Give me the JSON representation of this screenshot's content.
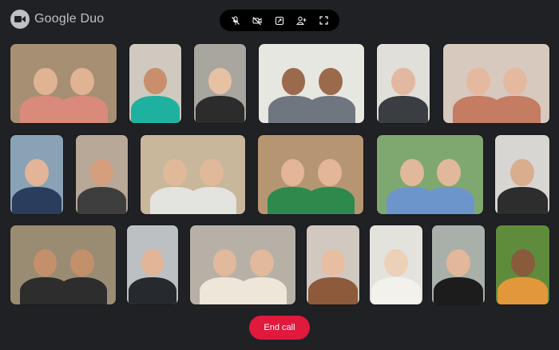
{
  "app": {
    "name": "Google Duo"
  },
  "toolbar": {
    "buttons": [
      {
        "name": "mute-mic-button",
        "icon": "mic-off-icon"
      },
      {
        "name": "camera-off-button",
        "icon": "video-off-icon"
      },
      {
        "name": "switch-view-button",
        "icon": "switch-view-icon"
      },
      {
        "name": "add-person-button",
        "icon": "person-add-icon"
      },
      {
        "name": "fullscreen-button",
        "icon": "fullscreen-icon"
      }
    ]
  },
  "participants": [
    {
      "bg": "#a68f73",
      "skin": "#e0b393",
      "shirt": "#d98a7a"
    },
    {
      "bg": "#cfc9bf",
      "skin": "#c98f6c",
      "shirt": "#1fb1a0"
    },
    {
      "bg": "#a9a59f",
      "skin": "#e6c2a3",
      "shirt": "#2c2c2c"
    },
    {
      "bg": "#e7e7e2",
      "skin": "#9b6a4c",
      "shirt": "#6f7680"
    },
    {
      "bg": "#e0dfda",
      "skin": "#e2b8a0",
      "shirt": "#3a3d42"
    },
    {
      "bg": "#d7c9be",
      "skin": "#e5b8a0",
      "shirt": "#c47c62"
    },
    {
      "bg": "#8aa2b5",
      "skin": "#e2b498",
      "shirt": "#2a3d5c"
    },
    {
      "bg": "#b8a897",
      "skin": "#d59f7e",
      "shirt": "#3e3e3e"
    },
    {
      "bg": "#c9b79b",
      "skin": "#e0b89a",
      "shirt": "#e3e3e0"
    },
    {
      "bg": "#b69672",
      "skin": "#e3b697",
      "shirt": "#2d8a4c"
    },
    {
      "bg": "#7fa871",
      "skin": "#e2b89a",
      "shirt": "#6c95cc"
    },
    {
      "bg": "#d8d6d2",
      "skin": "#d9ae8e",
      "shirt": "#2d2d2d"
    },
    {
      "bg": "#9a8c72",
      "skin": "#c4906c",
      "shirt": "#2d2d2d"
    },
    {
      "bg": "#bcc0c3",
      "skin": "#e1b596",
      "shirt": "#26292e"
    },
    {
      "bg": "#b6b0a7",
      "skin": "#e2b99c",
      "shirt": "#efe6da"
    },
    {
      "bg": "#d1c9c0",
      "skin": "#e7bea2",
      "shirt": "#8d5a3c"
    },
    {
      "bg": "#e4e2dd",
      "skin": "#ecd0b8",
      "shirt": "#f3f1ec"
    },
    {
      "bg": "#a8b0a9",
      "skin": "#e3b799",
      "shirt": "#1c1c1c"
    },
    {
      "bg": "#5f8b3c",
      "skin": "#8a5a3c",
      "shirt": "#e2983a"
    },
    {
      "bg": "#2e3a4c",
      "skin": "#c7977a",
      "shirt": "#3a4a66"
    }
  ],
  "end_call": {
    "label": "End call"
  }
}
